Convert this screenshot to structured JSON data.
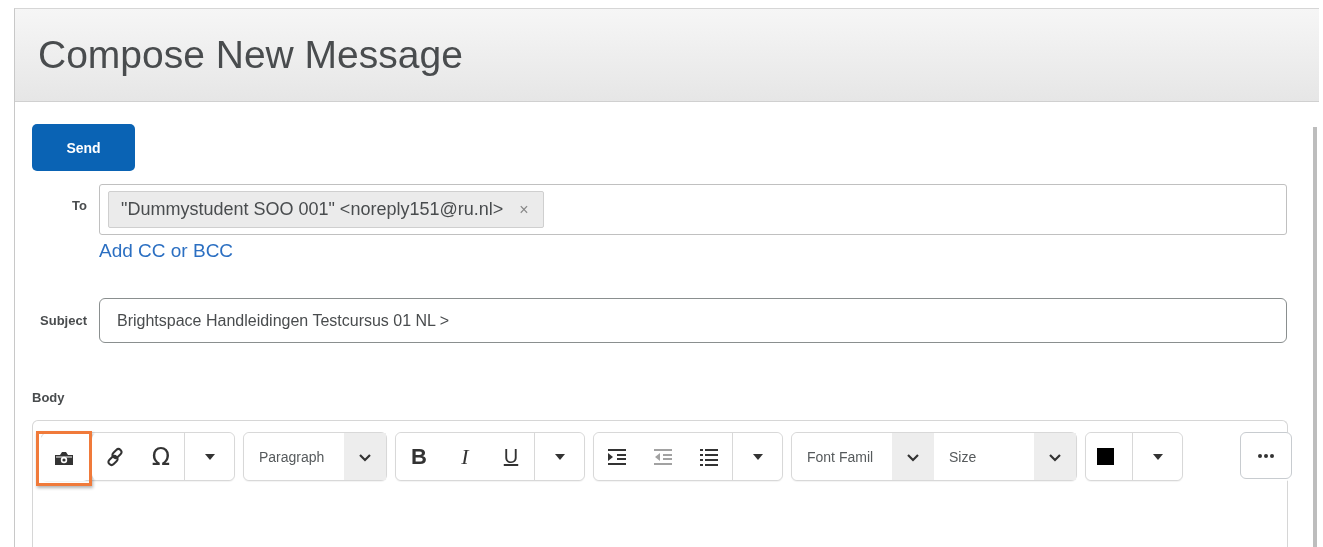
{
  "page": {
    "title": "Compose New Message"
  },
  "send_button": {
    "label": "Send"
  },
  "to": {
    "label": "To",
    "recipients": [
      {
        "text": "\"Dummystudent SOO 001\" <noreply151@ru.nl>",
        "remove": "×"
      }
    ],
    "add_cc_link": "Add CC or BCC"
  },
  "subject": {
    "label": "Subject",
    "value": "Brightspace Handleidingen Testcursus 01 NL >"
  },
  "body": {
    "label": "Body",
    "toolbar": [
      {
        "kind": "buttons",
        "items": [
          {
            "kind": "image",
            "highlighted": true,
            "disabled": false
          },
          {
            "kind": "link",
            "highlighted": false,
            "disabled": false
          },
          {
            "kind": "char",
            "label": "Ω",
            "highlighted": false,
            "disabled": false
          },
          {
            "kind": "caret",
            "highlighted": false,
            "disabled": false
          }
        ]
      },
      {
        "kind": "selects",
        "items": [
          {
            "kind": "select",
            "label": "Paragraph",
            "highlighted": false,
            "disabled": false
          }
        ]
      },
      {
        "kind": "buttons",
        "items": [
          {
            "kind": "bold",
            "label": "B",
            "highlighted": false,
            "disabled": false
          },
          {
            "kind": "italic",
            "label": "I",
            "highlighted": false,
            "disabled": false
          },
          {
            "kind": "underline",
            "label": "U",
            "highlighted": false,
            "disabled": false
          },
          {
            "kind": "caret",
            "highlighted": false,
            "disabled": false
          }
        ]
      },
      {
        "kind": "buttons",
        "items": [
          {
            "kind": "indent",
            "highlighted": false,
            "disabled": false
          },
          {
            "kind": "outdent",
            "highlighted": false,
            "disabled": true
          },
          {
            "kind": "list",
            "highlighted": false,
            "disabled": false
          },
          {
            "kind": "caret",
            "highlighted": false,
            "disabled": false
          }
        ]
      },
      {
        "kind": "selects",
        "items": [
          {
            "kind": "select",
            "label": "Font Famil",
            "highlighted": false,
            "disabled": false
          },
          {
            "kind": "select",
            "label": "Size",
            "highlighted": false,
            "disabled": false
          }
        ]
      },
      {
        "kind": "buttons",
        "items": [
          {
            "kind": "swatch",
            "color": "#000000",
            "highlighted": false,
            "disabled": false
          },
          {
            "kind": "caret",
            "highlighted": false,
            "disabled": false
          }
        ]
      },
      {
        "kind": "more",
        "items": [
          {
            "kind": "more",
            "highlighted": false,
            "disabled": false
          }
        ]
      }
    ]
  }
}
